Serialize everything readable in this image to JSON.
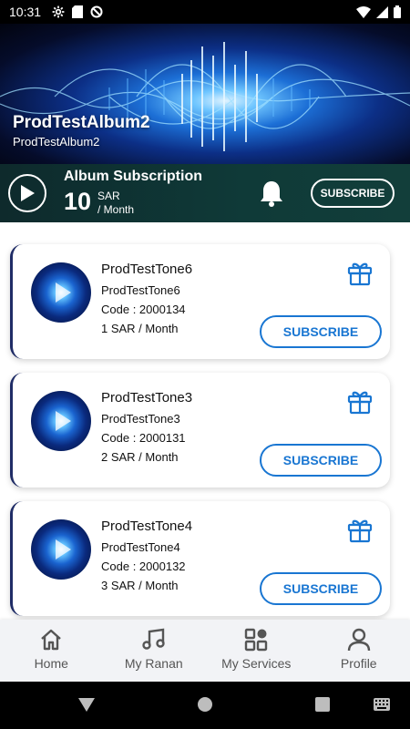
{
  "status_bar": {
    "time": "10:31"
  },
  "album": {
    "title": "ProdTestAlbum2",
    "subtitle": "ProdTestAlbum2"
  },
  "subscription": {
    "title": "Album Subscription",
    "price": "10",
    "currency": "SAR",
    "period": "/ Month",
    "button_label": "SUBSCRIBE"
  },
  "tones": [
    {
      "name": "ProdTestTone6",
      "subtitle": "ProdTestTone6",
      "code": "Code : 2000134",
      "price": "1 SAR / Month",
      "button_label": "SUBSCRIBE"
    },
    {
      "name": "ProdTestTone3",
      "subtitle": "ProdTestTone3",
      "code": "Code : 2000131",
      "price": "2 SAR / Month",
      "button_label": "SUBSCRIBE"
    },
    {
      "name": "ProdTestTone4",
      "subtitle": "ProdTestTone4",
      "code": "Code : 2000132",
      "price": "3 SAR / Month",
      "button_label": "SUBSCRIBE"
    }
  ],
  "bottom_nav": [
    {
      "label": "Home",
      "icon": "home-icon"
    },
    {
      "label": "My Ranan",
      "icon": "music-note-icon"
    },
    {
      "label": "My Services",
      "icon": "services-grid-icon"
    },
    {
      "label": "Profile",
      "icon": "profile-icon"
    }
  ],
  "colors": {
    "accent": "#1976d2",
    "sub_bar_bg": "#0f3a38",
    "card_border": "#1f2c66",
    "status_bar_bg": "#000000"
  }
}
